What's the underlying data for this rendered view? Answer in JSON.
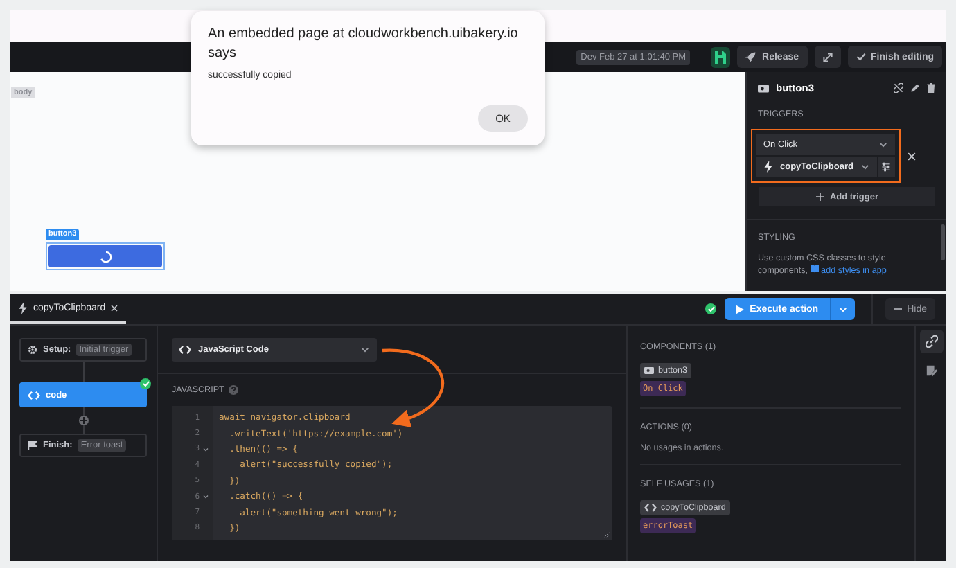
{
  "dialog": {
    "title": "An embedded page at cloudworkbench.uibakery.io says",
    "message": "successfully copied",
    "button": "OK"
  },
  "toolbar": {
    "timestamp": "Dev Feb 27 at 1:01:40 PM",
    "release": "Release",
    "finish": "Finish editing"
  },
  "canvas": {
    "body_label": "body",
    "component_label": "button3",
    "component_loading": true
  },
  "inspector": {
    "title": "button3",
    "triggers_heading": "TRIGGERS",
    "trigger_event": "On Click",
    "trigger_action": "copyToClipboard",
    "add_trigger": "Add trigger",
    "styling_heading": "STYLING",
    "styling_text": "Use custom CSS classes to style components,",
    "styling_link": "add styles in app"
  },
  "editor": {
    "tabs": [
      {
        "label": "copyToClipboard",
        "selected": true
      }
    ],
    "steps": [
      {
        "kind": "setup",
        "label": "Setup:",
        "tag": "Initial trigger",
        "selected": false,
        "done": false
      },
      {
        "kind": "code",
        "label": "code",
        "selected": true,
        "done": true
      },
      {
        "kind": "finish",
        "label": "Finish:",
        "tag": "Error toast",
        "selected": false,
        "done": false
      }
    ],
    "action_type": "JavaScript Code",
    "javascript_label": "JAVASCRIPT",
    "code": [
      {
        "number": "1",
        "text": "await navigator.clipboard",
        "foldable": false
      },
      {
        "number": "2",
        "text": "  .writeText('https://example.com')",
        "foldable": false
      },
      {
        "number": "3",
        "text": "  .then(() => {",
        "foldable": true
      },
      {
        "number": "4",
        "text": "    alert(\"successfully copied\");",
        "foldable": false
      },
      {
        "number": "5",
        "text": "  })",
        "foldable": false
      },
      {
        "number": "6",
        "text": "  .catch(() => {",
        "foldable": true
      },
      {
        "number": "7",
        "text": "    alert(\"something went wrong\");",
        "foldable": false
      },
      {
        "number": "8",
        "text": "  })",
        "foldable": false
      }
    ],
    "execute": "Execute action",
    "hide": "Hide",
    "usages": [
      {
        "heading": "COMPONENTS (1)",
        "items": [
          {
            "kind": "component",
            "name": "button3",
            "tag": "On Click"
          }
        ]
      },
      {
        "heading": "ACTIONS (0)",
        "empty": "No usages in actions."
      },
      {
        "heading": "SELF USAGES (1)",
        "items": [
          {
            "kind": "code",
            "name": "copyToClipboard",
            "tag": "errorToast"
          }
        ]
      }
    ],
    "side_tools": [
      {
        "kind": "link",
        "selected": true
      },
      {
        "kind": "notes",
        "selected": false
      }
    ]
  }
}
